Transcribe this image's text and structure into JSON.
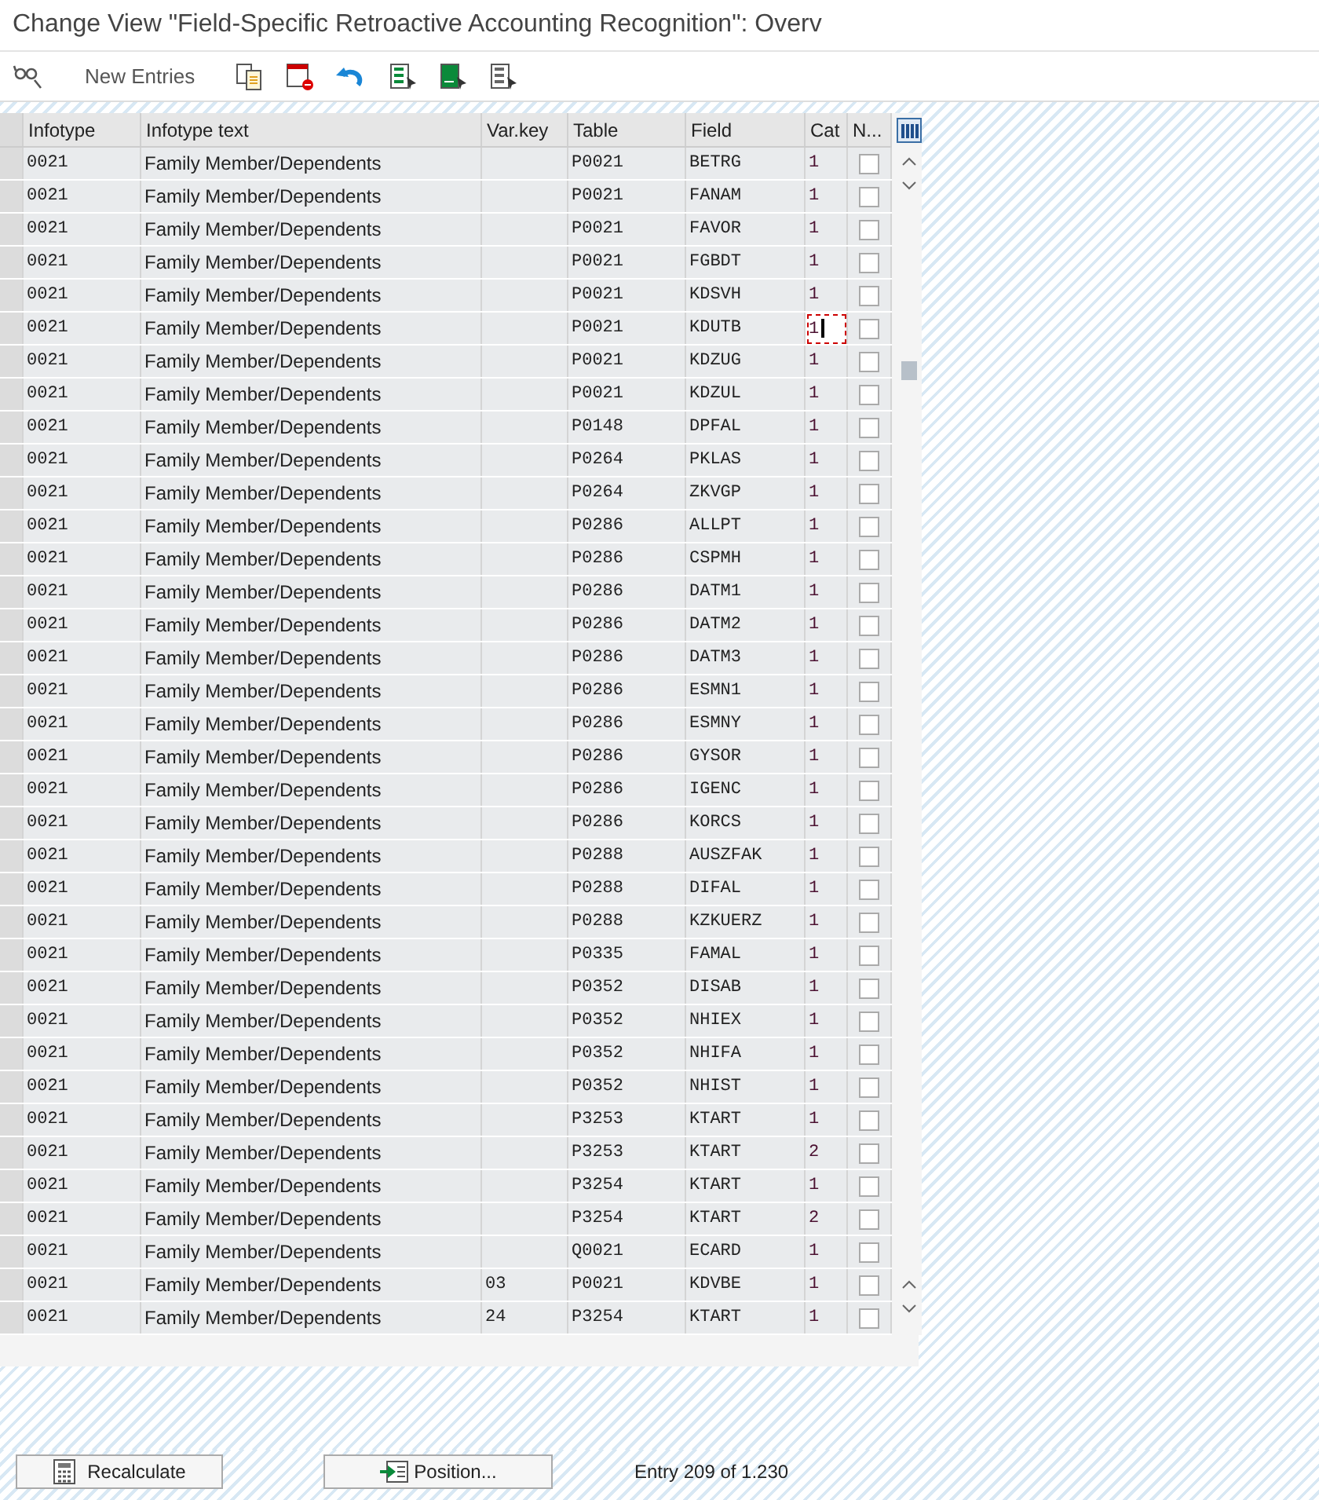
{
  "window": {
    "title": "Change View \"Field-Specific Retroactive Accounting Recognition\": Overv"
  },
  "toolbar": {
    "new_entries": "New Entries"
  },
  "table": {
    "columns": [
      "Infotype",
      "Infotype text",
      "Var.key",
      "Table",
      "Field",
      "Cat",
      "N..."
    ],
    "rows": [
      {
        "infotype": "0021",
        "text": "Family Member/Dependents",
        "varkey": "",
        "table": "P0021",
        "field": "BETRG",
        "cat": "1",
        "checked": false,
        "focused": false
      },
      {
        "infotype": "0021",
        "text": "Family Member/Dependents",
        "varkey": "",
        "table": "P0021",
        "field": "FANAM",
        "cat": "1",
        "checked": false,
        "focused": false
      },
      {
        "infotype": "0021",
        "text": "Family Member/Dependents",
        "varkey": "",
        "table": "P0021",
        "field": "FAVOR",
        "cat": "1",
        "checked": false,
        "focused": false
      },
      {
        "infotype": "0021",
        "text": "Family Member/Dependents",
        "varkey": "",
        "table": "P0021",
        "field": "FGBDT",
        "cat": "1",
        "checked": false,
        "focused": false
      },
      {
        "infotype": "0021",
        "text": "Family Member/Dependents",
        "varkey": "",
        "table": "P0021",
        "field": "KDSVH",
        "cat": "1",
        "checked": false,
        "focused": false
      },
      {
        "infotype": "0021",
        "text": "Family Member/Dependents",
        "varkey": "",
        "table": "P0021",
        "field": "KDUTB",
        "cat": "1",
        "checked": false,
        "focused": true
      },
      {
        "infotype": "0021",
        "text": "Family Member/Dependents",
        "varkey": "",
        "table": "P0021",
        "field": "KDZUG",
        "cat": "1",
        "checked": false,
        "focused": false
      },
      {
        "infotype": "0021",
        "text": "Family Member/Dependents",
        "varkey": "",
        "table": "P0021",
        "field": "KDZUL",
        "cat": "1",
        "checked": false,
        "focused": false
      },
      {
        "infotype": "0021",
        "text": "Family Member/Dependents",
        "varkey": "",
        "table": "P0148",
        "field": "DPFAL",
        "cat": "1",
        "checked": false,
        "focused": false
      },
      {
        "infotype": "0021",
        "text": "Family Member/Dependents",
        "varkey": "",
        "table": "P0264",
        "field": "PKLAS",
        "cat": "1",
        "checked": false,
        "focused": false
      },
      {
        "infotype": "0021",
        "text": "Family Member/Dependents",
        "varkey": "",
        "table": "P0264",
        "field": "ZKVGP",
        "cat": "1",
        "checked": false,
        "focused": false
      },
      {
        "infotype": "0021",
        "text": "Family Member/Dependents",
        "varkey": "",
        "table": "P0286",
        "field": "ALLPT",
        "cat": "1",
        "checked": false,
        "focused": false
      },
      {
        "infotype": "0021",
        "text": "Family Member/Dependents",
        "varkey": "",
        "table": "P0286",
        "field": "CSPMH",
        "cat": "1",
        "checked": false,
        "focused": false
      },
      {
        "infotype": "0021",
        "text": "Family Member/Dependents",
        "varkey": "",
        "table": "P0286",
        "field": "DATM1",
        "cat": "1",
        "checked": false,
        "focused": false
      },
      {
        "infotype": "0021",
        "text": "Family Member/Dependents",
        "varkey": "",
        "table": "P0286",
        "field": "DATM2",
        "cat": "1",
        "checked": false,
        "focused": false
      },
      {
        "infotype": "0021",
        "text": "Family Member/Dependents",
        "varkey": "",
        "table": "P0286",
        "field": "DATM3",
        "cat": "1",
        "checked": false,
        "focused": false
      },
      {
        "infotype": "0021",
        "text": "Family Member/Dependents",
        "varkey": "",
        "table": "P0286",
        "field": "ESMN1",
        "cat": "1",
        "checked": false,
        "focused": false
      },
      {
        "infotype": "0021",
        "text": "Family Member/Dependents",
        "varkey": "",
        "table": "P0286",
        "field": "ESMNY",
        "cat": "1",
        "checked": false,
        "focused": false
      },
      {
        "infotype": "0021",
        "text": "Family Member/Dependents",
        "varkey": "",
        "table": "P0286",
        "field": "GYSOR",
        "cat": "1",
        "checked": false,
        "focused": false
      },
      {
        "infotype": "0021",
        "text": "Family Member/Dependents",
        "varkey": "",
        "table": "P0286",
        "field": "IGENC",
        "cat": "1",
        "checked": false,
        "focused": false
      },
      {
        "infotype": "0021",
        "text": "Family Member/Dependents",
        "varkey": "",
        "table": "P0286",
        "field": "KORCS",
        "cat": "1",
        "checked": false,
        "focused": false
      },
      {
        "infotype": "0021",
        "text": "Family Member/Dependents",
        "varkey": "",
        "table": "P0288",
        "field": "AUSZFAK",
        "cat": "1",
        "checked": false,
        "focused": false
      },
      {
        "infotype": "0021",
        "text": "Family Member/Dependents",
        "varkey": "",
        "table": "P0288",
        "field": "DIFAL",
        "cat": "1",
        "checked": false,
        "focused": false
      },
      {
        "infotype": "0021",
        "text": "Family Member/Dependents",
        "varkey": "",
        "table": "P0288",
        "field": "KZKUERZ",
        "cat": "1",
        "checked": false,
        "focused": false
      },
      {
        "infotype": "0021",
        "text": "Family Member/Dependents",
        "varkey": "",
        "table": "P0335",
        "field": "FAMAL",
        "cat": "1",
        "checked": false,
        "focused": false
      },
      {
        "infotype": "0021",
        "text": "Family Member/Dependents",
        "varkey": "",
        "table": "P0352",
        "field": "DISAB",
        "cat": "1",
        "checked": false,
        "focused": false
      },
      {
        "infotype": "0021",
        "text": "Family Member/Dependents",
        "varkey": "",
        "table": "P0352",
        "field": "NHIEX",
        "cat": "1",
        "checked": false,
        "focused": false
      },
      {
        "infotype": "0021",
        "text": "Family Member/Dependents",
        "varkey": "",
        "table": "P0352",
        "field": "NHIFA",
        "cat": "1",
        "checked": false,
        "focused": false
      },
      {
        "infotype": "0021",
        "text": "Family Member/Dependents",
        "varkey": "",
        "table": "P0352",
        "field": "NHIST",
        "cat": "1",
        "checked": false,
        "focused": false
      },
      {
        "infotype": "0021",
        "text": "Family Member/Dependents",
        "varkey": "",
        "table": "P3253",
        "field": "KTART",
        "cat": "1",
        "checked": false,
        "focused": false
      },
      {
        "infotype": "0021",
        "text": "Family Member/Dependents",
        "varkey": "",
        "table": "P3253",
        "field": "KTART",
        "cat": "2",
        "checked": false,
        "focused": false
      },
      {
        "infotype": "0021",
        "text": "Family Member/Dependents",
        "varkey": "",
        "table": "P3254",
        "field": "KTART",
        "cat": "1",
        "checked": false,
        "focused": false
      },
      {
        "infotype": "0021",
        "text": "Family Member/Dependents",
        "varkey": "",
        "table": "P3254",
        "field": "KTART",
        "cat": "2",
        "checked": false,
        "focused": false
      },
      {
        "infotype": "0021",
        "text": "Family Member/Dependents",
        "varkey": "",
        "table": "Q0021",
        "field": "ECARD",
        "cat": "1",
        "checked": false,
        "focused": false
      },
      {
        "infotype": "0021",
        "text": "Family Member/Dependents",
        "varkey": "03",
        "table": "P0021",
        "field": "KDVBE",
        "cat": "1",
        "checked": false,
        "focused": false
      },
      {
        "infotype": "0021",
        "text": "Family Member/Dependents",
        "varkey": "24",
        "table": "P3254",
        "field": "KTART",
        "cat": "1",
        "checked": false,
        "focused": false
      }
    ]
  },
  "footer": {
    "recalculate": "Recalculate",
    "position": "Position...",
    "entry_info": "Entry 209 of 1.230"
  }
}
